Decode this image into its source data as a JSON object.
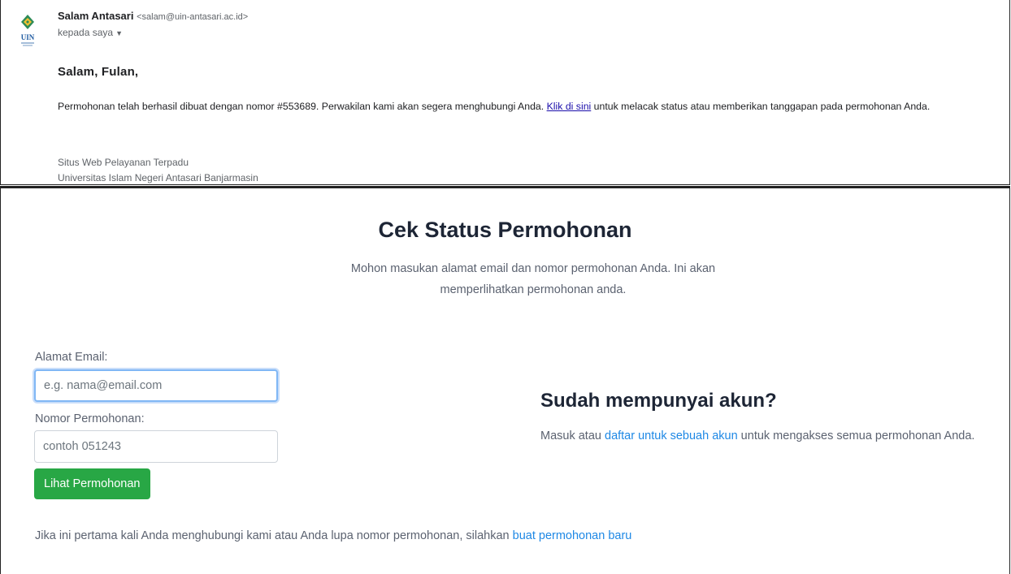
{
  "email": {
    "logo_text": "UIN",
    "sender_name": "Salam Antasari",
    "sender_email": "<salam@uin-antasari.ac.id>",
    "to": "kepada saya",
    "greeting": "Salam, Fulan,",
    "message_before": "Permohonan telah berhasil dibuat dengan nomor #553689. Perwakilan kami akan segera menghubungi Anda. ",
    "message_link": "Klik di sini",
    "message_after": " untuk melacak status atau memberikan tanggapan pada permohonan Anda.",
    "signature_line1": "Situs Web Pelayanan Terpadu",
    "signature_line2": "Universitas Islam Negeri Antasari Banjarmasin"
  },
  "page": {
    "title": "Cek Status Permohonan",
    "description": "Mohon masukan alamat email dan nomor permohonan Anda. Ini akan memperlihatkan permohonan anda.",
    "email_label": "Alamat Email:",
    "email_placeholder": "e.g. nama@email.com",
    "number_label": "Nomor Permohonan:",
    "number_placeholder": "contoh 051243",
    "submit_label": "Lihat Permohonan",
    "account_title": "Sudah mempunyai akun?",
    "account_before": "Masuk atau ",
    "account_link": "daftar untuk sebuah akun",
    "account_after": " untuk mengakses semua permohonan Anda.",
    "footer_before": "Jika ini pertama kali Anda menghubungi kami atau Anda lupa nomor permohonan, silahkan ",
    "footer_link": "buat permohonan baru"
  },
  "colors": {
    "button_green": "#28a745",
    "link_blue": "#1e88e5",
    "email_link": "#1a0dab",
    "heading": "#1d2535"
  }
}
